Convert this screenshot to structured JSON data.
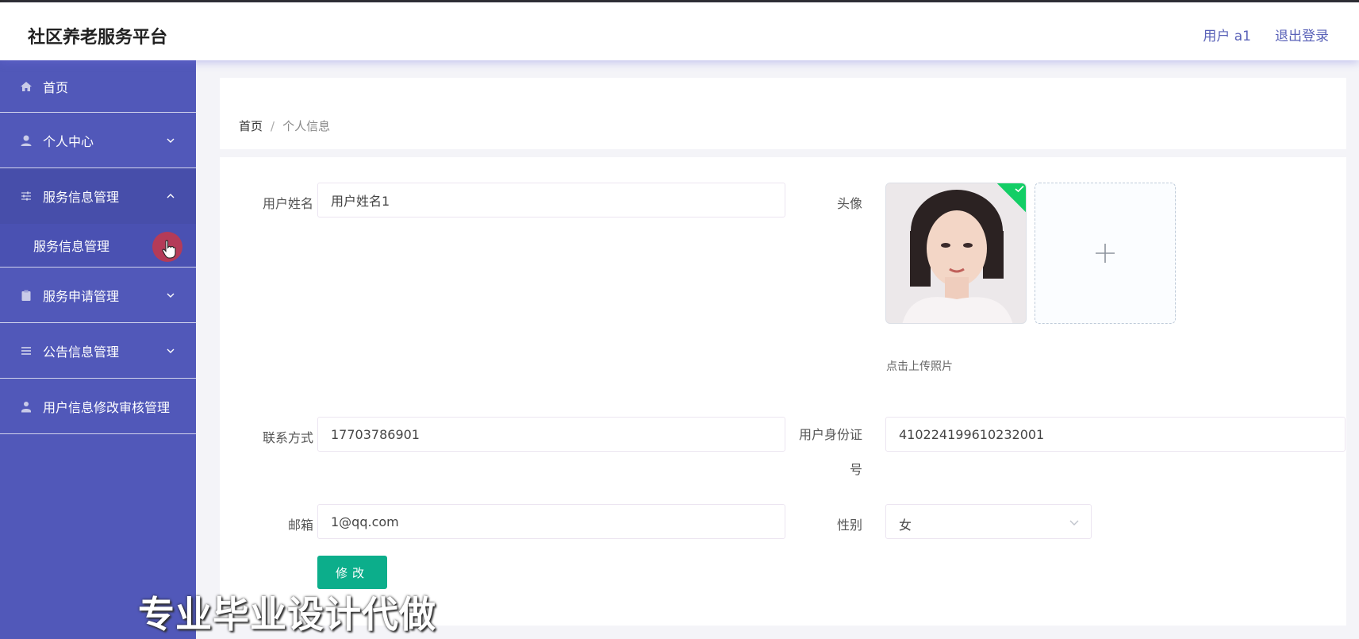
{
  "app": {
    "title": "社区养老服务平台"
  },
  "header": {
    "user_label": "用户 a1",
    "logout_label": "退出登录"
  },
  "sidebar": {
    "items": [
      {
        "label": "首页",
        "icon": "home-icon"
      },
      {
        "label": "个人中心",
        "icon": "user-icon"
      },
      {
        "label": "服务信息管理",
        "icon": "sliders-icon",
        "expanded": true,
        "children": [
          {
            "label": "服务信息管理"
          }
        ]
      },
      {
        "label": "服务申请管理",
        "icon": "clipboard-icon"
      },
      {
        "label": "公告信息管理",
        "icon": "list-icon"
      },
      {
        "label": "用户信息修改审核管理",
        "icon": "user-upload-icon"
      }
    ]
  },
  "breadcrumb": {
    "home": "首页",
    "separator": "/",
    "current": "个人信息"
  },
  "form": {
    "username": {
      "label": "用户姓名",
      "value": "用户姓名1"
    },
    "avatar": {
      "label": "头像",
      "upload_tip": "点击上传照片"
    },
    "phone": {
      "label": "联系方式",
      "value": "17703786901"
    },
    "id_number": {
      "label": "用户身份证号",
      "value": "410224199610232001"
    },
    "email": {
      "label": "邮箱",
      "value": "1@qq.com"
    },
    "gender": {
      "label": "性别",
      "value": "女"
    },
    "submit_label": "修改"
  },
  "watermark": "专业毕业设计代做",
  "colors": {
    "sidebar": "#5158b9",
    "header_link": "#5a62b8",
    "submit_button": "#0cae8b",
    "upload_success": "#13ce66"
  }
}
